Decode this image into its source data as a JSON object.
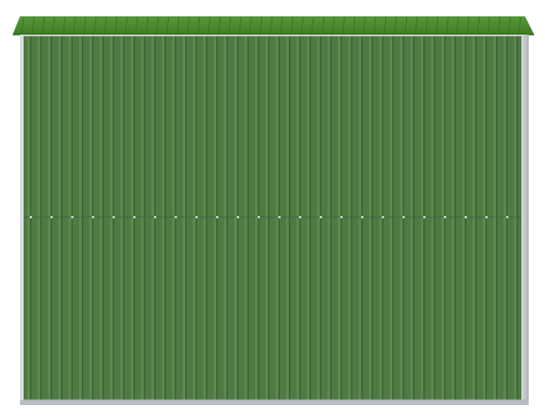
{
  "image": {
    "subject": "shed-wall",
    "colors": {
      "background": "#ffffff",
      "panel_base": "#4f7a43",
      "panel_light": "#5c8a50",
      "panel_dark": "#3d6334",
      "roof": "#4a8a2f",
      "roof_edge": "#3b7025",
      "frame": "#c9cdd0",
      "frame_shadow": "#9aa0a4",
      "rivet": "#d9dde0"
    },
    "icons": [
      "shed-panel",
      "roof",
      "frame",
      "rivet"
    ]
  }
}
